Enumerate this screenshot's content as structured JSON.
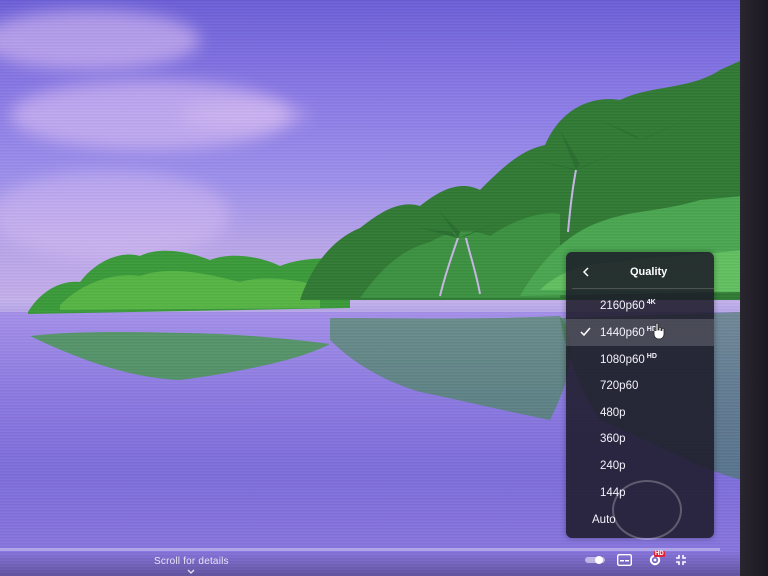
{
  "player": {
    "scroll_hint": "Scroll for details",
    "hd_badge": "HD"
  },
  "quality_menu": {
    "title": "Quality",
    "selected_index": 1,
    "options": [
      {
        "label": "2160p60",
        "badge": "4K"
      },
      {
        "label": "1440p60",
        "badge": "HD"
      },
      {
        "label": "1080p60",
        "badge": "HD"
      },
      {
        "label": "720p60",
        "badge": ""
      },
      {
        "label": "480p",
        "badge": ""
      },
      {
        "label": "360p",
        "badge": ""
      },
      {
        "label": "240p",
        "badge": ""
      },
      {
        "label": "144p",
        "badge": ""
      },
      {
        "label": "Auto",
        "badge": ""
      }
    ]
  },
  "colors": {
    "menu_bg": "#1c1a28",
    "hd_badge": "#e0243a"
  },
  "icons": {
    "back": "chevron-left-icon",
    "selected": "check-icon",
    "autoplay": "autoplay-toggle-icon",
    "subtitles": "subtitles-icon",
    "settings": "settings-gear-icon",
    "fullscreen": "exit-fullscreen-icon",
    "scroll": "chevron-down-icon"
  }
}
